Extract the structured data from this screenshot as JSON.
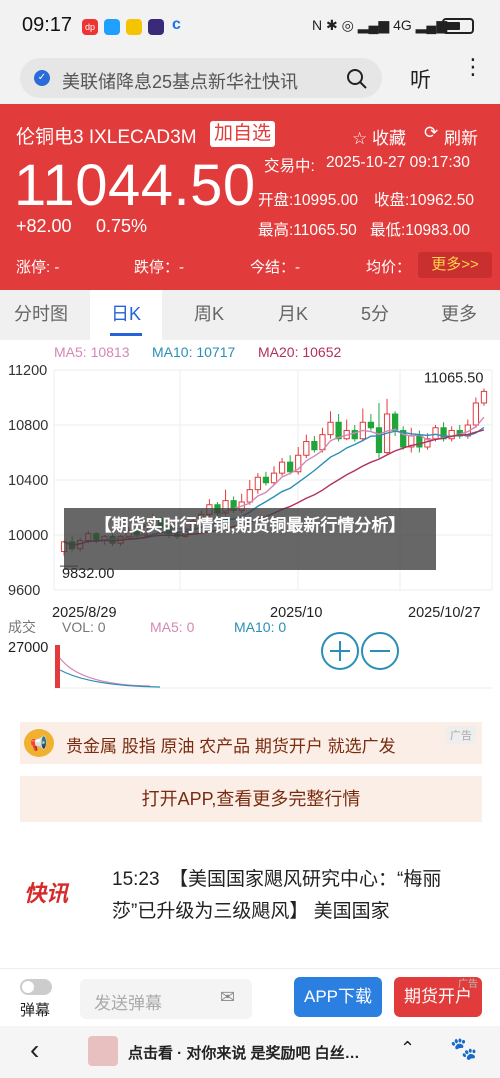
{
  "status_bar": {
    "time": "09:17",
    "app_icons": [
      "dp",
      "blue-square",
      "yellow-app",
      "purple-app",
      "c"
    ],
    "battery": "battery-icon"
  },
  "search": {
    "query": "美联储降息25基点新华社快讯",
    "listen_label": "听"
  },
  "quote": {
    "name": "伦铜电3 IXLECAD3M",
    "add_label": "加自选",
    "fav_label": "☆ 收藏",
    "refresh_label": "刷新",
    "price": "11044.50",
    "change": "+82.00",
    "change_pct": "0.75%",
    "trade_time_label": "交易中:",
    "trade_time": "2025-10-27 09:17:30",
    "open": "开盘:10995.00",
    "prev_close": "收盘:10962.50",
    "high": "最高:11065.50",
    "low": "最低:10983.00",
    "limit_up": "涨停: -",
    "limit_down": "跌停：-",
    "today_settle": "今结：-",
    "avg": "均价：",
    "more": "更多>>"
  },
  "tabs": [
    "分时图",
    "日K",
    "周K",
    "月K",
    "5分",
    "更多"
  ],
  "active_tab": "日K",
  "ma_legend": {
    "ma5": "MA5: 10813",
    "ma10": "MA10: 10717",
    "ma20": "MA20: 10652"
  },
  "chart_data": {
    "type": "candlestick",
    "y_ticks": [
      "11200",
      "10800",
      "10400",
      "10000",
      "9600"
    ],
    "x_ticks": [
      "2025/8/29",
      "2025/10",
      "2025/10/27"
    ],
    "ylim": [
      9600,
      11200
    ],
    "max_label": "11065.50",
    "min_label": "9832.00",
    "vol_label": "成交",
    "vol": "VOL: 0",
    "vol_ma5": "MA5: 0",
    "vol_ma10": "MA10: 0",
    "vol_tick": "27000",
    "candles": [
      [
        9880,
        9950,
        9850,
        9960
      ],
      [
        9950,
        9900,
        9880,
        9990
      ],
      [
        9900,
        9960,
        9880,
        9980
      ],
      [
        9960,
        10010,
        9940,
        10030
      ],
      [
        10010,
        9960,
        9940,
        10020
      ],
      [
        9960,
        9990,
        9930,
        10000
      ],
      [
        9990,
        9940,
        9920,
        10010
      ],
      [
        9940,
        9990,
        9920,
        10000
      ],
      [
        9990,
        10030,
        9970,
        10060
      ],
      [
        10030,
        10000,
        9980,
        10050
      ],
      [
        10000,
        10060,
        9990,
        10080
      ],
      [
        10060,
        10120,
        10040,
        10150
      ],
      [
        10120,
        10060,
        10040,
        10130
      ],
      [
        10060,
        10010,
        9980,
        10070
      ],
      [
        10010,
        9990,
        9970,
        10030
      ],
      [
        9990,
        10040,
        9980,
        10060
      ],
      [
        10040,
        10100,
        10020,
        10130
      ],
      [
        10100,
        10150,
        10080,
        10180
      ],
      [
        10150,
        10220,
        10130,
        10260
      ],
      [
        10220,
        10160,
        10140,
        10240
      ],
      [
        10160,
        10250,
        10140,
        10330
      ],
      [
        10250,
        10180,
        10160,
        10280
      ],
      [
        10180,
        10240,
        10160,
        10300
      ],
      [
        10240,
        10330,
        10220,
        10400
      ],
      [
        10330,
        10420,
        10300,
        10450
      ],
      [
        10420,
        10380,
        10360,
        10460
      ],
      [
        10380,
        10450,
        10360,
        10500
      ],
      [
        10450,
        10530,
        10430,
        10560
      ],
      [
        10530,
        10460,
        10440,
        10580
      ],
      [
        10460,
        10580,
        10440,
        10640
      ],
      [
        10580,
        10680,
        10560,
        10730
      ],
      [
        10680,
        10620,
        10600,
        10720
      ],
      [
        10620,
        10730,
        10600,
        10780
      ],
      [
        10730,
        10820,
        10700,
        10900
      ],
      [
        10820,
        10700,
        10680,
        10880
      ],
      [
        10700,
        10760,
        10690,
        10840
      ],
      [
        10760,
        10700,
        10680,
        10800
      ],
      [
        10700,
        10820,
        10680,
        10920
      ],
      [
        10820,
        10780,
        10760,
        10880
      ],
      [
        10780,
        10600,
        10560,
        10960
      ],
      [
        10600,
        10880,
        10580,
        10990
      ],
      [
        10880,
        10760,
        10720,
        10900
      ],
      [
        10760,
        10640,
        10620,
        10790
      ],
      [
        10640,
        10720,
        10600,
        10780
      ],
      [
        10720,
        10640,
        10600,
        10760
      ],
      [
        10640,
        10700,
        10620,
        10740
      ],
      [
        10700,
        10780,
        10680,
        10800
      ],
      [
        10780,
        10700,
        10680,
        10820
      ],
      [
        10700,
        10760,
        10680,
        10790
      ],
      [
        10760,
        10720,
        10700,
        10800
      ],
      [
        10720,
        10800,
        10700,
        10840
      ],
      [
        10800,
        10960,
        10780,
        11000
      ],
      [
        10960,
        11044.5,
        10940,
        11065.5
      ]
    ]
  },
  "ads": {
    "tag": "广告",
    "banner": "贵金属 股指 原油 农产品 期货开户 就选广发",
    "cta": "打开APP,查看更多完整行情"
  },
  "overlay": "【期货实时行情铜,期货铜最新行情分析】",
  "news": {
    "logo": "快讯",
    "text": "15:23　【美国国家飓风研究中心：“梅丽莎”已升级为三级飓风】 美国国家"
  },
  "bottom": {
    "danmu": "弹幕",
    "send_placeholder": "发送弹幕",
    "app_download": "APP下载",
    "open_account": "期货开户",
    "ad_tag": "广告"
  },
  "nav": {
    "back": "back-icon",
    "feed_text": "点击看 · 对你来说 是奖励吧 白丝…",
    "up": "chevron-up-icon"
  }
}
